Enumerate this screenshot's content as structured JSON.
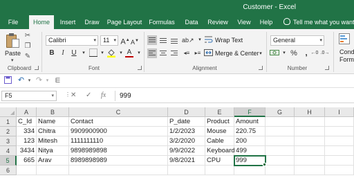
{
  "window": {
    "title": "Customer  -  Excel"
  },
  "tabs": [
    {
      "label": "File"
    },
    {
      "label": "Home"
    },
    {
      "label": "Insert"
    },
    {
      "label": "Draw"
    },
    {
      "label": "Page Layout"
    },
    {
      "label": "Formulas"
    },
    {
      "label": "Data"
    },
    {
      "label": "Review"
    },
    {
      "label": "View"
    },
    {
      "label": "Help"
    }
  ],
  "tell_me": "Tell me what you want t",
  "ribbon": {
    "clipboard": {
      "paste_label": "Paste",
      "group_label": "Clipboard"
    },
    "font": {
      "font_name": "Calibri",
      "font_size": "11",
      "group_label": "Font",
      "font_color": "#c00000",
      "fill_color": "#ffff00"
    },
    "alignment": {
      "wrap_text": "Wrap Text",
      "merge_center": "Merge & Center",
      "group_label": "Alignment"
    },
    "number": {
      "format": "General",
      "group_label": "Number"
    },
    "styles": {
      "cond_line1": "Cond",
      "cond_line2": "Forma"
    }
  },
  "formula_bar": {
    "name_box": "F5",
    "fx": "fx",
    "formula": "999"
  },
  "sheet": {
    "columns": [
      "A",
      "B",
      "C",
      "D",
      "E",
      "F",
      "G",
      "H",
      "I"
    ],
    "selected_column": "F",
    "selected_row": "5",
    "rows": [
      {
        "num": "1",
        "cells": [
          "C_Id",
          "Name",
          "Contact",
          "P_date",
          "Product",
          "Amount",
          "",
          "",
          ""
        ]
      },
      {
        "num": "2",
        "cells": [
          "334",
          "Chitra",
          "9909900900",
          "1/2/2023",
          "Mouse",
          "220.75",
          "",
          "",
          ""
        ]
      },
      {
        "num": "3",
        "cells": [
          "123",
          "Mitesh",
          "1111111110",
          "3/2/2020",
          "Cable",
          "200",
          "",
          "",
          ""
        ]
      },
      {
        "num": "4",
        "cells": [
          "3434",
          "Nitya",
          "9898989898",
          "9/9/2022",
          "Keyboard",
          "499",
          "",
          "",
          ""
        ]
      },
      {
        "num": "5",
        "cells": [
          "665",
          "Arav",
          "8989898989",
          "9/8/2021",
          "CPU",
          "999",
          "",
          "",
          ""
        ]
      },
      {
        "num": "6",
        "cells": [
          "",
          "",
          "",
          "",
          "",
          "",
          "",
          "",
          ""
        ]
      }
    ],
    "accent": "#217346"
  }
}
